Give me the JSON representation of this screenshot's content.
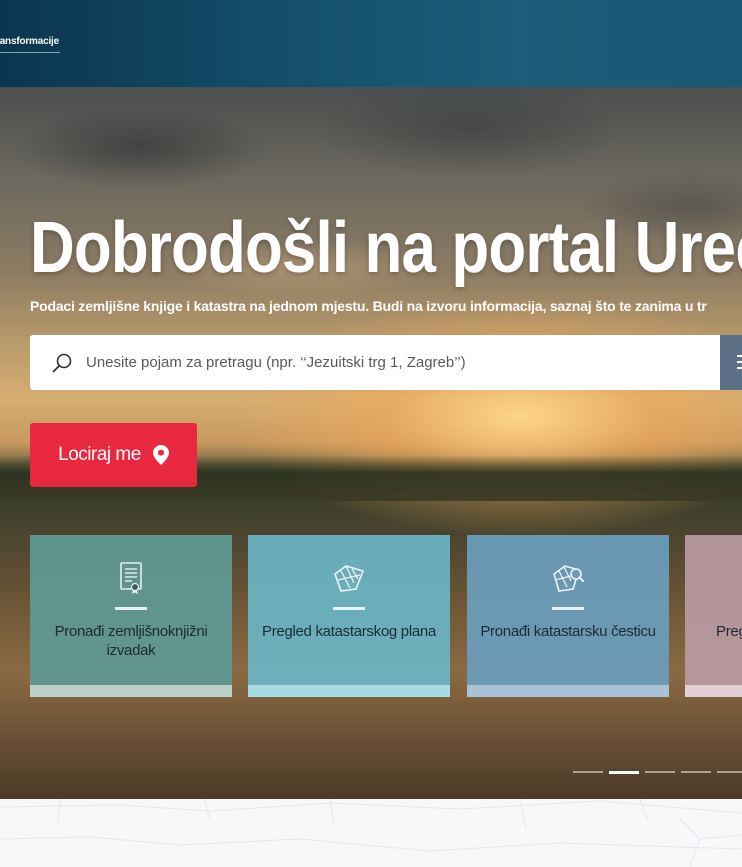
{
  "header": {
    "brand_text": "ransformacije"
  },
  "hero": {
    "title": "Dobrodošli na portal Uređ",
    "subtitle": "Podaci zemljišne knjige i katastra na jednom mjestu. Budi na izvoru informacija, saznaj što te zanima u tr",
    "search": {
      "placeholder": "Unesite pojam za pretragu (npr. ‘‘Jezuitski trg 1, Zagreb’’)"
    },
    "locate_button": {
      "label": "Lociraj me"
    }
  },
  "cards": [
    {
      "label": "Pronađi zemljišnoknjižni izvadak",
      "icon": "document-certificate-icon",
      "color": "#5f9a93",
      "bar_color": "#b9cfc8"
    },
    {
      "label": "Pregled katastarskog plana",
      "icon": "map-plan-icon",
      "color": "#6ab5c5",
      "bar_color": "#a7dbe4"
    },
    {
      "label": "Pronađi katastarsku česticu",
      "icon": "map-search-icon",
      "color": "#6a9dbb",
      "bar_color": "#a8c2d6"
    },
    {
      "label": "Preg",
      "icon": "generic-icon",
      "color": "#b99aa3",
      "bar_color": "#e3cfd6"
    }
  ],
  "carousel": {
    "slide_count": 5,
    "active_index": 1
  },
  "colors": {
    "accent_red": "#e8283f",
    "header_blue": "#14506b",
    "search_button": "#5b6f87"
  }
}
